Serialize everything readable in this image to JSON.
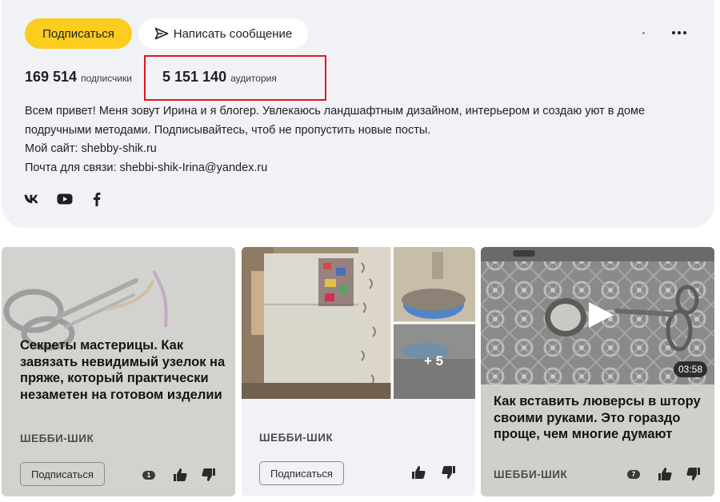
{
  "profile": {
    "subscribe_label": "Подписаться",
    "message_label": "Написать сообщение",
    "subscribers_count": "169 514",
    "subscribers_label": "подписчики",
    "audience_count": "5 151 140",
    "audience_label": "аудитория",
    "bio_lines": [
      "Всем привет! Меня зовут Ирина и я блогер. Увлекаюсь ландшафтным дизайном, интерьером и создаю уют в доме",
      "подручными методами. Подписывайтесь, чтоб не пропустить новые посты.",
      "Мой сайт: shebby-shik.ru",
      "Почта для связи: shebbi-shik-Irina@yandex.ru"
    ],
    "social_icons": [
      "vk-icon",
      "youtube-icon",
      "facebook-icon"
    ]
  },
  "cards": [
    {
      "title": "Секреты мастерицы. Как завязать невидимый узелок на пряже, который практически незаметен на готовом изделии",
      "channel": "ШЕББИ-ШИК",
      "subscribe_label": "Подписаться",
      "comments": "1"
    },
    {
      "channel": "ШЕББИ-ШИК",
      "subscribe_label": "Подписаться",
      "more_photos": "+ 5"
    },
    {
      "title": "Как вставить люверсы в штору своими руками. Это гораздо проще, чем многие думают",
      "channel": "ШЕББИ-ШИК",
      "duration": "03:58",
      "comments": "7"
    }
  ],
  "colors": {
    "accent_yellow": "#fccc1e",
    "panel_bg": "#f1f2f6",
    "highlight_red": "#e3141b"
  }
}
